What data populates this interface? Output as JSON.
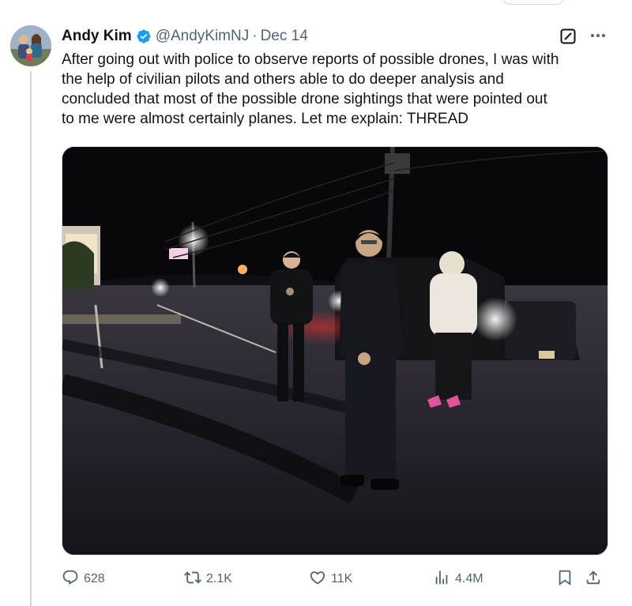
{
  "tweet": {
    "author_name": "Andy Kim",
    "handle": "@AndyKimNJ",
    "separator": "·",
    "date": "Dec 14",
    "text": "After going out with police to observe reports of possible drones, I was with\nthe help of civilian pilots and others able to do deeper analysis and\nconcluded that most of the possible drone sightings that were pointed out\nto me were almost certainly planes. Let me explain: THREAD",
    "verified": true,
    "verified_color": "#1d9bf0"
  },
  "stats": {
    "replies": "628",
    "reposts": "2.1K",
    "likes": "11K",
    "views": "4.4M"
  },
  "icons": {
    "reply": "reply-icon",
    "repost": "repost-icon",
    "like": "like-icon",
    "views": "views-icon",
    "bookmark": "bookmark-icon",
    "share": "share-icon",
    "grok": "grok-icon",
    "more": "more-icon"
  },
  "colors": {
    "text": "#0f1419",
    "muted": "#536471",
    "border": "#cfd9de",
    "accent": "#1d9bf0"
  }
}
